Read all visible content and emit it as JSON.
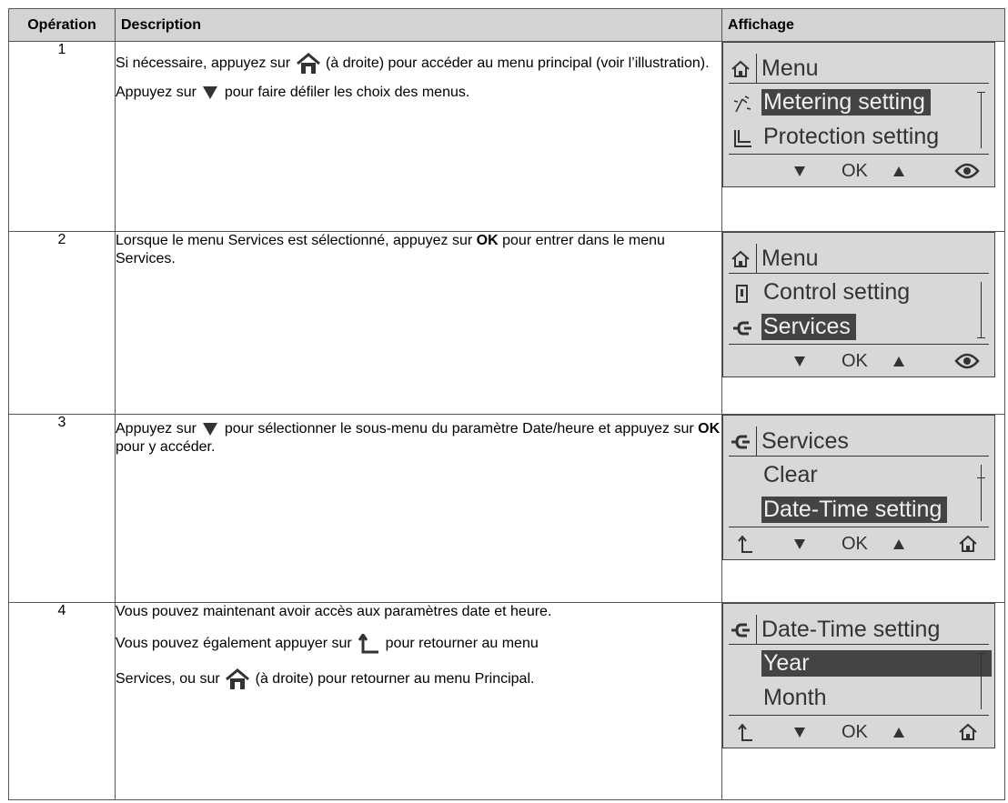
{
  "table": {
    "headers": {
      "operation": "Opération",
      "description": "Description",
      "display": "Affichage"
    },
    "rows": [
      {
        "num": "1",
        "p1_a": "Si nécessaire, appuyez sur",
        "p1_b": "(à droite) pour accéder au menu principal (voir l’illustration).",
        "p2_a": "Appuyez sur",
        "p2_b": "pour faire défiler les choix des menus."
      },
      {
        "num": "2",
        "p1_a": "Lorsque le menu Services est sélectionné, appuyez sur",
        "p1_ok": "OK",
        "p1_b": "pour entrer dans le menu Services."
      },
      {
        "num": "3",
        "p1_a": "Appuyez sur",
        "p1_b": "pour sélectionner le sous-menu du paramètre Date/heure et appuyez sur",
        "p1_ok": "OK",
        "p1_c": "pour y accéder."
      },
      {
        "num": "4",
        "p1": "Vous pouvez maintenant avoir accès aux paramètres date et heure.",
        "p2_a": "Vous pouvez également appuyer sur",
        "p2_b": "pour retourner au menu",
        "p3_a": "Services, ou sur",
        "p3_b": "(à droite) pour retourner au menu Principal."
      }
    ]
  },
  "screens": [
    {
      "title": "Menu",
      "title_icon": "home-icon",
      "items": [
        {
          "label": "Metering setting",
          "icon": "metering-icon",
          "selected": true
        },
        {
          "label": "Protection setting",
          "icon": "protection-curve-icon",
          "selected": false
        }
      ],
      "footer": {
        "ok": "OK"
      }
    },
    {
      "title": "Menu",
      "title_icon": "home-icon",
      "items": [
        {
          "label": "Control setting",
          "icon": "control-icon",
          "selected": false
        },
        {
          "label": "Services",
          "icon": "plug-icon",
          "selected": true
        }
      ],
      "footer": {
        "ok": "OK"
      }
    },
    {
      "title": "Services",
      "title_icon": "plug-icon",
      "items": [
        {
          "label": "Clear",
          "selected": false
        },
        {
          "label": "Date-Time setting",
          "selected": true
        }
      ],
      "footer": {
        "ok": "OK"
      }
    },
    {
      "title": "Date-Time setting",
      "title_icon": "plug-icon",
      "items": [
        {
          "label": "Year",
          "selected": true
        },
        {
          "label": "Month",
          "selected": false
        }
      ],
      "footer": {
        "ok": "OK"
      }
    }
  ]
}
